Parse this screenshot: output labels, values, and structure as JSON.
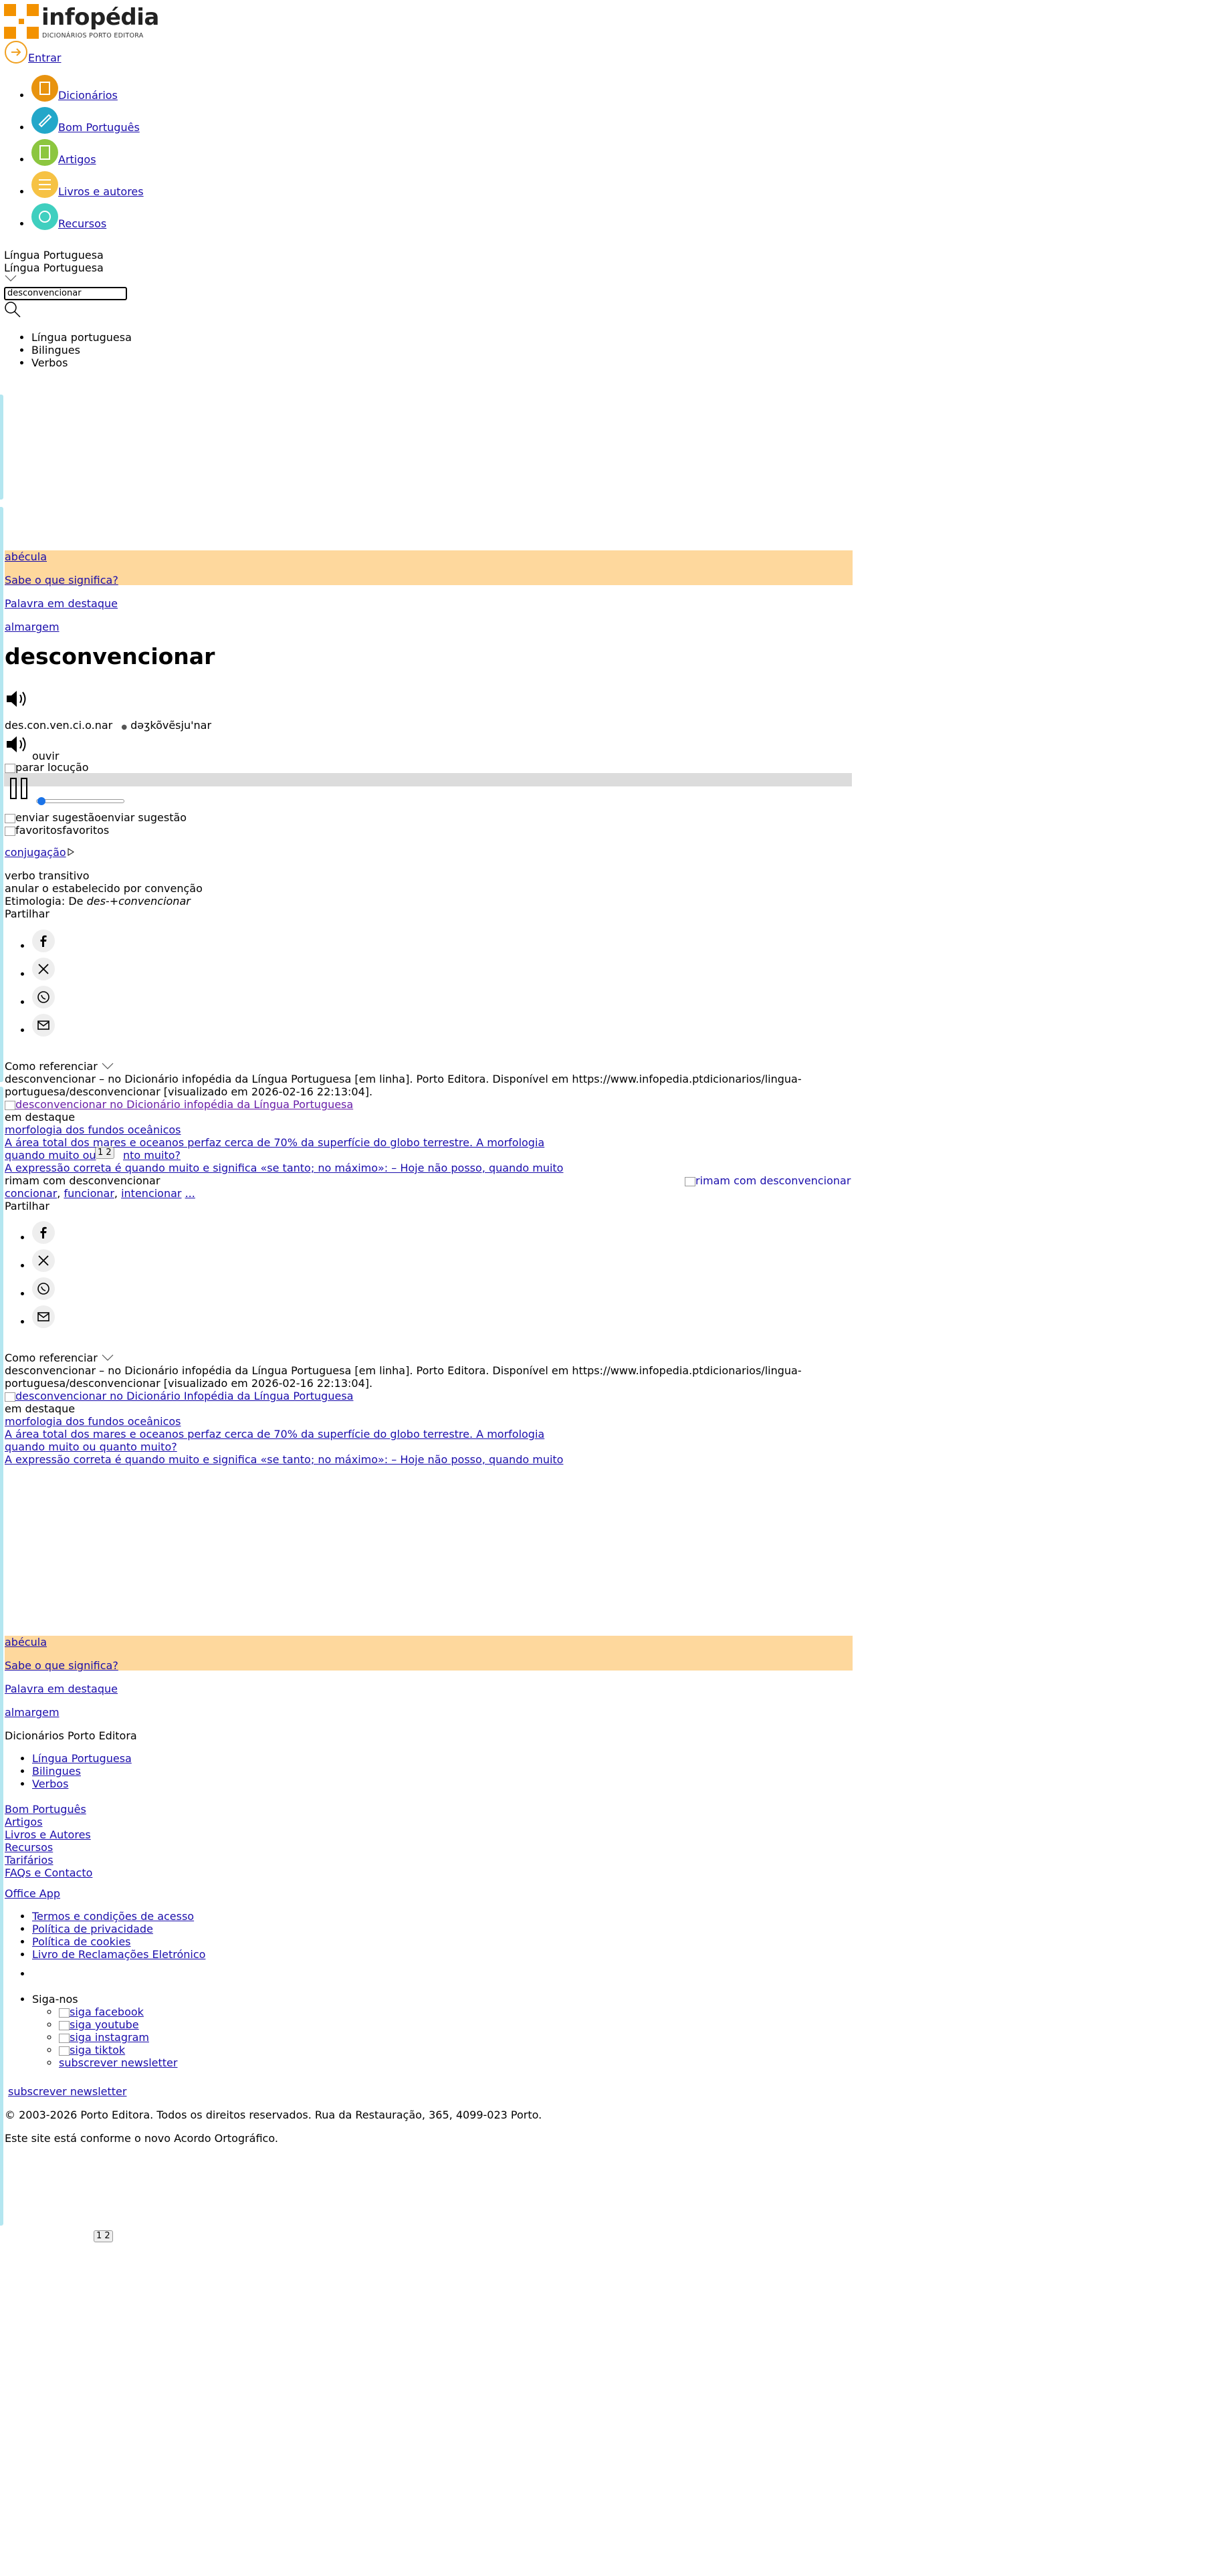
{
  "header": {
    "logo_word": "infopédia",
    "logo_sub": "DICIONÁRIOS PORTO EDITORA",
    "login_label": "Entrar"
  },
  "nav": [
    {
      "label": "Dicionários",
      "color": "#e8930f"
    },
    {
      "label": "Bom Português",
      "color": "#22a7c9"
    },
    {
      "label": "Artigos",
      "color": "#8cc63f"
    },
    {
      "label": "Livros e autores",
      "color": "#f6c244"
    },
    {
      "label": "Recursos",
      "color": "#3fcfbf"
    }
  ],
  "search": {
    "dictionary_selected": "Língua Portuguesa",
    "dictionary_selected_2": "Língua Portuguesa",
    "query": "desconvencionar",
    "options": [
      "Língua portuguesa",
      "Bilingues",
      "Verbos"
    ]
  },
  "sidebar_links": {
    "abecula": "abécula",
    "sabe": "Sabe o que significa?",
    "palavra": "Palavra em destaque",
    "almargem": "almargem"
  },
  "entry": {
    "headword": "desconvencionar",
    "syllables": "des.con.ven.ci.o.nar",
    "phonetic": "dəʒkõvẽsju'nar",
    "listen_label": "ouvir",
    "stop_alt": "parar locução",
    "suggest_label": "enviar sugestão",
    "favorites_label": "favoritos",
    "conjugation_label": "conjugação",
    "pos": "verbo transitivo",
    "definition": "anular o estabelecido por convenção",
    "etymology_prefix": "Etimologia: De ",
    "etymology_italic": "des-+convencionar"
  },
  "share": {
    "label": "Partilhar",
    "networks": [
      "facebook-icon",
      "x-icon",
      "whatsapp-icon",
      "email-icon"
    ]
  },
  "reference": {
    "label": "Como referenciar",
    "text_line1": "desconvencionar – no Dicionário infopédia da Língua Portuguesa [em linha]. Porto Editora. Disponível em https://www.infopedia.ptdicionarios/lingua-",
    "text_line2": "portuguesa/desconvencionar [visualizado em 2026-02-16 22:13:04].",
    "image_link_1": "desconvencionar no Dicionário infopédia da Língua Portuguesa",
    "image_link_2": "desconvencionar no Dicionário Infopédia da Língua Portuguesa"
  },
  "featured": {
    "label": "em destaque",
    "title": "morfologia dos fundos oceânicos",
    "snippet": "A área total dos mares e oceanos perfaz cerca de 70% da superfície do globo terrestre. A morfologia",
    "q_title_a": "quando muito ou",
    "q_title_b": "nto muito?",
    "q_title_full": "quando muito ou quanto muito?",
    "q_snippet": "A expressão correta é quando muito e significa «se tanto; no máximo»: – Hoje não posso, quando muito",
    "pager": "1 2"
  },
  "rhymes": {
    "label": "rimam com desconvencionar",
    "image_alt": "rimam com desconvencionar",
    "items": [
      "concionar",
      "funcionar",
      "intencionar"
    ],
    "more": "..."
  },
  "footer": {
    "heading": "Dicionários Porto Editora",
    "dict_links": [
      "Língua Portuguesa",
      "Bilingues",
      "Verbos"
    ],
    "links": [
      "Bom Português",
      "Artigos",
      "Livros e Autores",
      "Recursos",
      "Tarifários",
      "FAQs e Contacto"
    ],
    "office_app": "Office App",
    "legal": [
      "Termos e condições de acesso",
      "Política de privacidade",
      "Política de cookies",
      "Livro de Reclamações Eletrónico"
    ],
    "follow_label": "Siga-nos",
    "socials": [
      "siga facebook",
      "siga youtube",
      "siga instagram",
      "siga tiktok"
    ],
    "newsletter": "subscrever newsletter",
    "newsletter_2": "subscrever newsletter",
    "copyright": "© 2003-2026 Porto Editora. Todos os direitos reservados. Rua da Restauração, 365, 4099-023 Porto.",
    "ao_note": "Este site está conforme o novo Acordo Ortográfico.",
    "bottom_pager": "1 2"
  }
}
